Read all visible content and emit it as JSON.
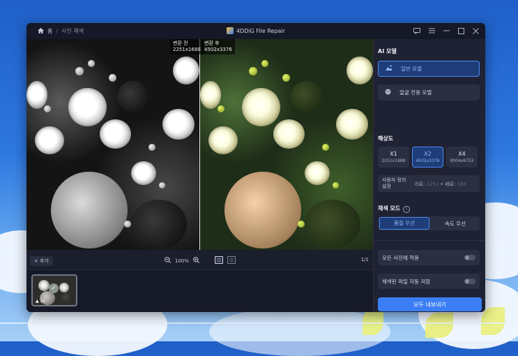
{
  "titlebar": {
    "home_label": "홈",
    "separator": "/",
    "current": "사진 채색",
    "app_title": "4DDiG File Repair"
  },
  "compare": {
    "before_label": "변환 전",
    "before_size": "2251x1688",
    "after_label": "변환 후",
    "after_size": "4502x3376"
  },
  "imgbar": {
    "add_label": "+ 추가",
    "zoom_value": "100%",
    "page": "1/1"
  },
  "thumb": {
    "scale": "2x"
  },
  "panel": {
    "ai_model_title": "AI 모델",
    "models": [
      {
        "label": "일반 모델",
        "icon": "landscape-icon",
        "active": true
      },
      {
        "label": "얼굴 전용 모델",
        "icon": "face-icon",
        "active": false
      }
    ],
    "resolution_title": "해상도",
    "resolutions": [
      {
        "name": "X1",
        "dims": "2251x1688",
        "active": false
      },
      {
        "name": "X2",
        "dims": "4502x3376",
        "active": true
      },
      {
        "name": "X4",
        "dims": "9004x6752",
        "active": false
      }
    ],
    "custom_label": "사용자 정의 설정",
    "width_label": "가로:",
    "width_value": "2251",
    "height_label": "세로:",
    "height_value": "168",
    "dot": "•",
    "color_mode_title": "채색 모드",
    "modes": [
      {
        "label": "품질 우선",
        "active": true
      },
      {
        "label": "속도 우선",
        "active": false
      }
    ],
    "apply_all": "모든 사진에 적용",
    "auto_save": "채색된 파일 자동 저장",
    "export_label": "모두 내보내기"
  },
  "colors": {
    "accent": "#3b7ef5",
    "active_bg": "#1f3d78",
    "panel_bg": "#1f2233",
    "window_bg": "#1b1e2b",
    "success": "#2bb673"
  }
}
